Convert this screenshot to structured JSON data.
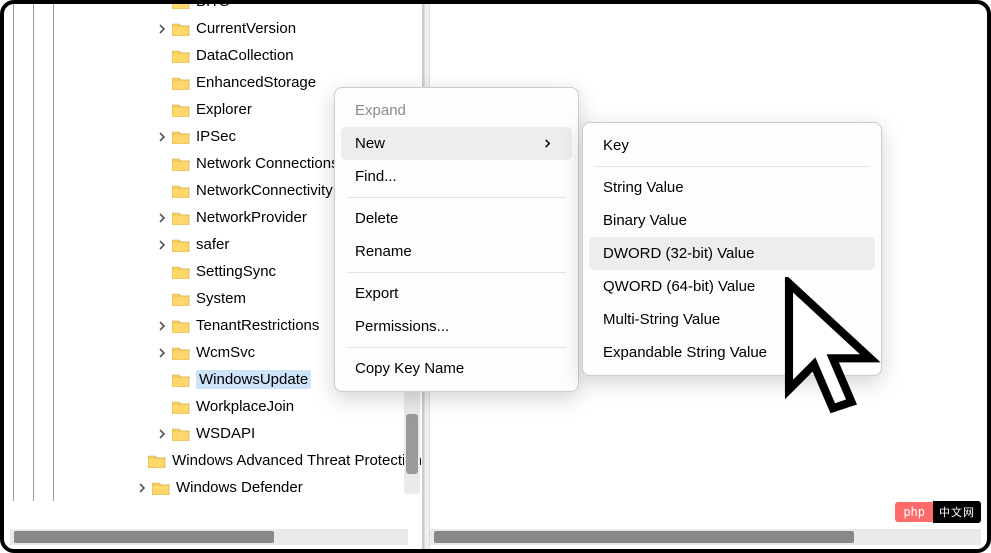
{
  "tree": {
    "nodes": [
      {
        "label": "BITS",
        "depth": 5,
        "hasExpander": false
      },
      {
        "label": "CurrentVersion",
        "depth": 5,
        "hasExpander": true
      },
      {
        "label": "DataCollection",
        "depth": 5,
        "hasExpander": false
      },
      {
        "label": "EnhancedStorage",
        "depth": 5,
        "hasExpander": false
      },
      {
        "label": "Explorer",
        "depth": 5,
        "hasExpander": false
      },
      {
        "label": "IPSec",
        "depth": 5,
        "hasExpander": true
      },
      {
        "label": "Network Connections",
        "depth": 5,
        "hasExpander": false
      },
      {
        "label": "NetworkConnectivity",
        "depth": 5,
        "hasExpander": false
      },
      {
        "label": "NetworkProvider",
        "depth": 5,
        "hasExpander": true
      },
      {
        "label": "safer",
        "depth": 5,
        "hasExpander": true
      },
      {
        "label": "SettingSync",
        "depth": 5,
        "hasExpander": false
      },
      {
        "label": "System",
        "depth": 5,
        "hasExpander": false
      },
      {
        "label": "TenantRestrictions",
        "depth": 5,
        "hasExpander": true
      },
      {
        "label": "WcmSvc",
        "depth": 5,
        "hasExpander": true
      },
      {
        "label": "WindowsUpdate",
        "depth": 5,
        "hasExpander": false,
        "selected": true
      },
      {
        "label": "WorkplaceJoin",
        "depth": 5,
        "hasExpander": false
      },
      {
        "label": "WSDAPI",
        "depth": 5,
        "hasExpander": true
      },
      {
        "label": "Windows Advanced Threat Protection",
        "depth": 4,
        "hasExpander": false
      },
      {
        "label": "Windows Defender",
        "depth": 4,
        "hasExpander": true
      }
    ]
  },
  "context_menu": {
    "items": [
      {
        "label": "Expand",
        "disabled": true
      },
      {
        "label": "New",
        "submenu": true,
        "hovered": true
      },
      {
        "label": "Find...",
        "group_end": true
      },
      {
        "label": "Delete"
      },
      {
        "label": "Rename",
        "group_end": true
      },
      {
        "label": "Export"
      },
      {
        "label": "Permissions...",
        "group_end": true
      },
      {
        "label": "Copy Key Name"
      }
    ]
  },
  "submenu": {
    "items": [
      {
        "label": "Key",
        "group_end": true
      },
      {
        "label": "String Value"
      },
      {
        "label": "Binary Value"
      },
      {
        "label": "DWORD (32-bit) Value",
        "hovered": true
      },
      {
        "label": "QWORD (64-bit) Value"
      },
      {
        "label": "Multi-String Value"
      },
      {
        "label": "Expandable String Value"
      }
    ]
  },
  "badge": {
    "left": "php",
    "right": "中文网"
  },
  "icons": {
    "chevron_right": ">",
    "chevron_down": "v"
  }
}
